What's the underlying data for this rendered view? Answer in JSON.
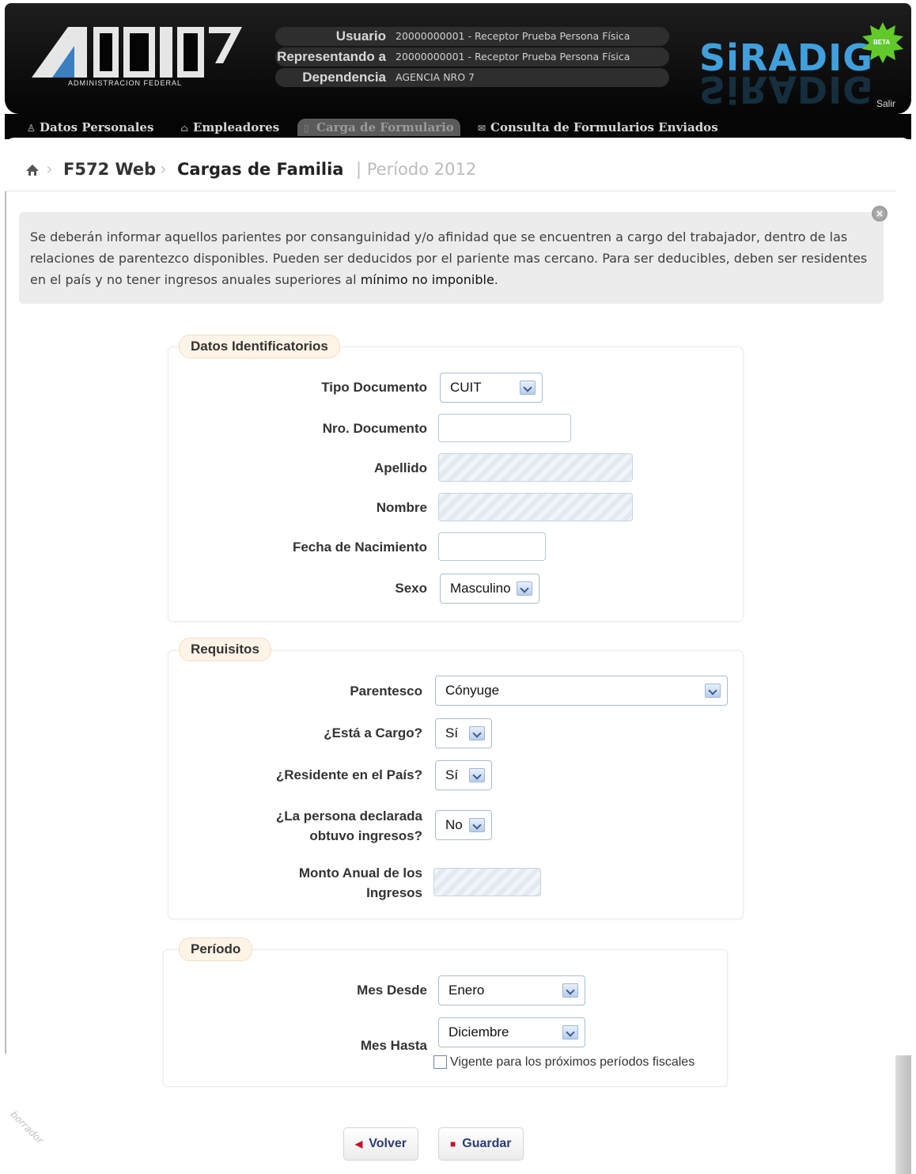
{
  "header": {
    "logo_subtitle": "ADMINISTRACION FEDERAL",
    "user_rows": [
      {
        "label": "Usuario",
        "value": "20000000001 - Receptor Prueba Persona Física"
      },
      {
        "label": "Representando a",
        "value": "20000000001 - Receptor Prueba Persona Física"
      },
      {
        "label": "Dependencia",
        "value": "AGENCIA NRO 7"
      }
    ],
    "app_name": "SiRADIG",
    "badge": "BETA",
    "logout": "Salir"
  },
  "nav": {
    "items": [
      {
        "label": "Datos Personales",
        "icon": "person-icon"
      },
      {
        "label": "Empleadores",
        "icon": "building-icon"
      },
      {
        "label": "Carga de Formulario",
        "icon": "form-icon"
      },
      {
        "label": "Consulta de Formularios Enviados",
        "icon": "envelope-icon"
      }
    ]
  },
  "breadcrumb": {
    "root": "F572 Web",
    "current": "Cargas de Familia",
    "period": "| Período 2012"
  },
  "info": {
    "text_before": "Se deberán informar aquellos parientes por consanguinidad y/o afinidad que se encuentren a cargo del trabajador, dentro de las relaciones de parentezco disponibles. Pueden ser deducidos por el pariente mas cercano. Para ser deducibles, deben ser residentes en el país y no tener ingresos anuales superiores al ",
    "link": "mínimo no imponible",
    "text_after": "."
  },
  "datos": {
    "legend": "Datos Identificatorios",
    "tipo_label": "Tipo Documento",
    "tipo_value": "CUIT",
    "nro_label": "Nro. Documento",
    "nro_value": "",
    "apellido_label": "Apellido",
    "nombre_label": "Nombre",
    "fecha_label": "Fecha de Nacimiento",
    "fecha_value": "",
    "sexo_label": "Sexo",
    "sexo_value": "Masculino"
  },
  "requisitos": {
    "legend": "Requisitos",
    "parentesco_label": "Parentesco",
    "parentesco_value": "Cónyuge",
    "cargo_label": "¿Está a Cargo?",
    "cargo_value": "Sí",
    "residente_label": "¿Residente en el País?",
    "residente_value": "Sí",
    "ingresos_label": "¿La persona declarada obtuvo ingresos?",
    "ingresos_value": "No",
    "monto_label": "Monto Anual de los Ingresos"
  },
  "periodo": {
    "legend": "Período",
    "desde_label": "Mes Desde",
    "desde_value": "Enero",
    "hasta_label": "Mes Hasta",
    "hasta_value": "Diciembre",
    "vigente_label": "Vigente para los próximos períodos fiscales",
    "vigente_checked": false
  },
  "buttons": {
    "volver": "Volver",
    "guardar": "Guardar"
  },
  "watermark": "borrador",
  "colors": {
    "header_bg": "#050505",
    "siradig_blue": "#3fa0dd",
    "beta_green": "#62c92b",
    "legend_bg": "#fff4e6",
    "button_text": "#2c3c74"
  }
}
